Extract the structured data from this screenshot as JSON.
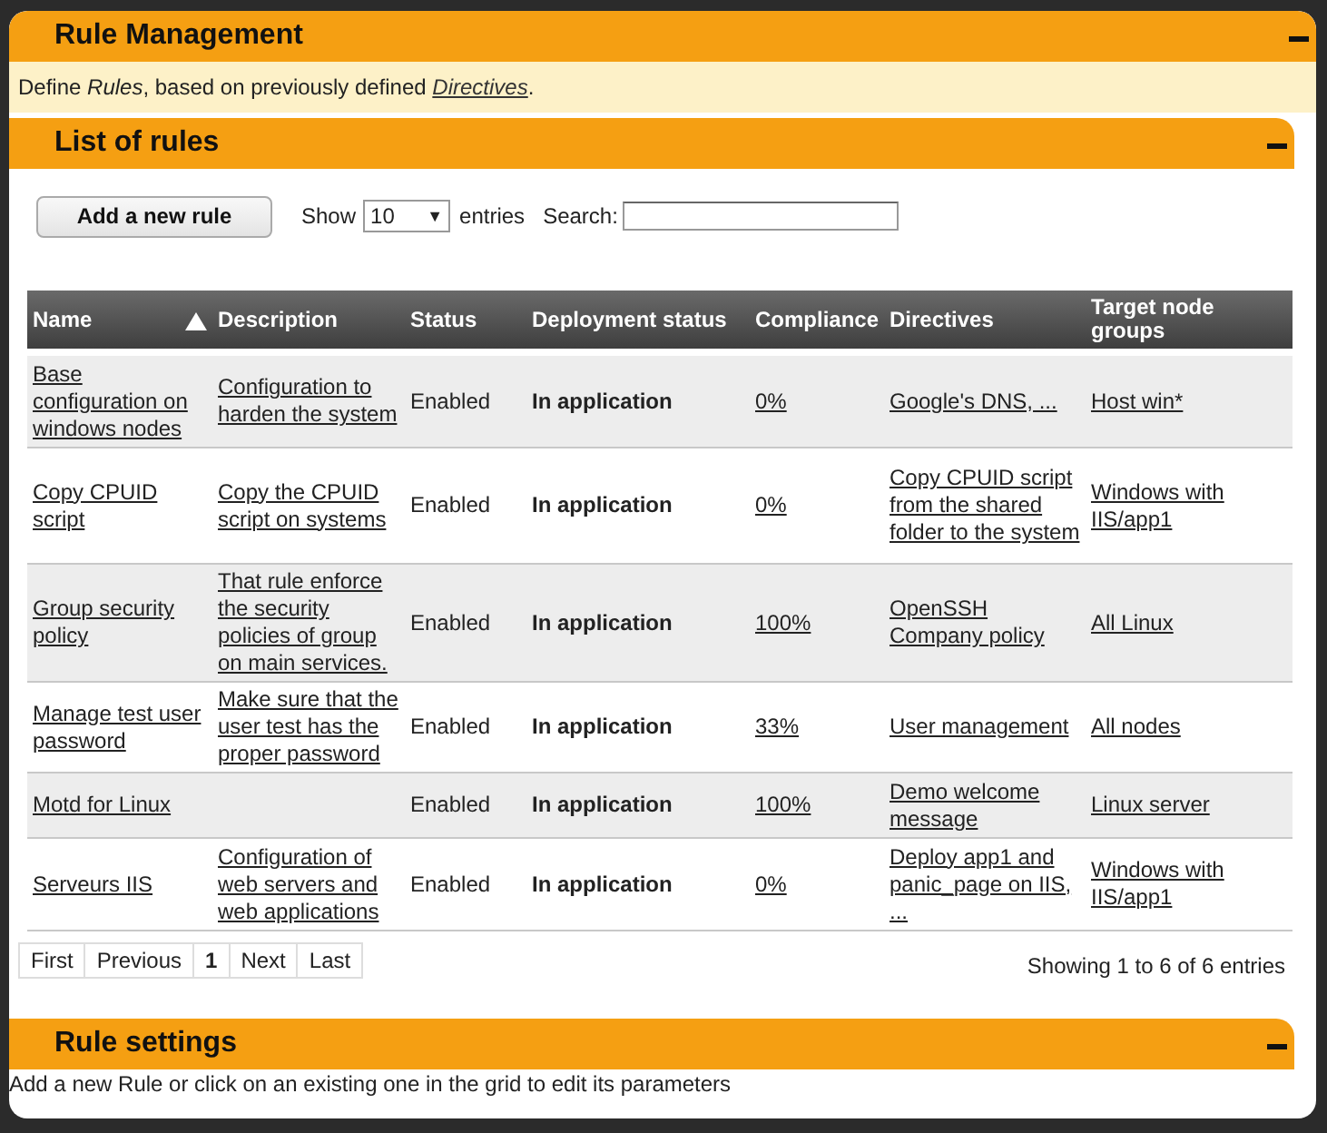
{
  "main_panel": {
    "title": "Rule Management"
  },
  "intro": {
    "before": "Define *Rules*, based on previously defined ",
    "link": "Directives",
    "after": "."
  },
  "list_panel": {
    "title": "List of rules"
  },
  "toolbar": {
    "add_button": "Add a new rule",
    "show_label": "Show",
    "page_size": "10",
    "page_size_caret": "▼",
    "entries_label": "entries",
    "search_label": "Search:"
  },
  "table": {
    "columns": [
      {
        "label": "Name",
        "sorted": true
      },
      {
        "label": "Description",
        "sorted": false
      },
      {
        "label": "Status",
        "sorted": false
      },
      {
        "label": "Deployment status",
        "sorted": false
      },
      {
        "label": "Compliance",
        "sorted": false
      },
      {
        "label": "Directives",
        "sorted": false
      },
      {
        "label": "Target node groups",
        "sorted": false
      }
    ],
    "rows": [
      {
        "name": "Base configuration on windows nodes",
        "description": "Configuration to harden the system",
        "status": "Enabled",
        "deployment": "In application",
        "compliance": "0%",
        "directives": "Google's DNS, ...",
        "target": "Host win*"
      },
      {
        "name": "Copy CPUID script",
        "description": "Copy the CPUID script on systems",
        "status": "Enabled",
        "deployment": "In application",
        "compliance": "0%",
        "directives": "Copy CPUID script from the shared folder to the system",
        "target": "Windows with IIS/app1"
      },
      {
        "name": "Group security policy",
        "description": "That rule enforce the security policies of group on main services.",
        "status": "Enabled",
        "deployment": "In application",
        "compliance": "100%",
        "directives": "OpenSSH Company policy",
        "target": "All Linux"
      },
      {
        "name": "Manage test user password",
        "description": "Make sure that the user test has the proper password",
        "status": "Enabled",
        "deployment": "In application",
        "compliance": "33%",
        "directives": "User management",
        "target": "All nodes"
      },
      {
        "name": "Motd for Linux",
        "description": "",
        "status": "Enabled",
        "deployment": "In application",
        "compliance": "100%",
        "directives": "Demo welcome message",
        "target": "Linux server"
      },
      {
        "name": "Serveurs IIS",
        "description": "Configuration of web servers and web applications",
        "status": "Enabled",
        "deployment": "In application",
        "compliance": "0%",
        "directives": "Deploy app1 and panic_page on IIS, ...",
        "target": "Windows with IIS/app1"
      }
    ]
  },
  "pager": {
    "buttons": [
      {
        "label": "First",
        "selected": false
      },
      {
        "label": "Previous",
        "selected": false
      },
      {
        "label": "1",
        "selected": true
      },
      {
        "label": "Next",
        "selected": false
      },
      {
        "label": "Last",
        "selected": false
      }
    ],
    "info": "Showing 1 to 6 of 6 entries"
  },
  "settings_panel": {
    "title": "Rule settings",
    "hint": "Add a new Rule or click on an existing one in the grid to edit its parameters"
  }
}
